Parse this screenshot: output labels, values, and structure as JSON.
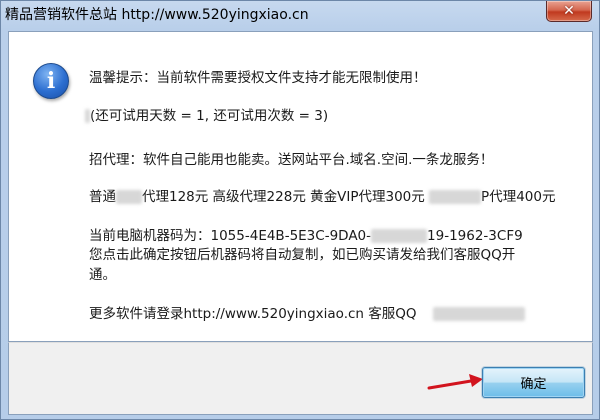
{
  "window": {
    "title": "精品营销软件总站 http://www.520yingxiao.cn",
    "close_symbol": "✕"
  },
  "dialog": {
    "icon": "info-icon",
    "lines": {
      "line1": "温馨提示：当前软件需要授权文件支持才能无限制使用！",
      "line2": "(还可试用天数 = 1, 还可试用次数 = 3)",
      "line3": "招代理：软件自己能用也能卖。送网站平台.域名.空间.一条龙服务！",
      "line4a": "普通",
      "line4b": "代理128元 高级代理228元 黄金VIP代理300元 ",
      "line4c": "P代理400元",
      "line5a": "当前电脑机器码为：1055-4E4B-5E3C-9DA0-",
      "line5b": "19-1962-3CF9",
      "line6": "您点击此确定按钮后机器码将自动复制，如已购买请发给我们客服QQ开",
      "line7": "通。",
      "line8": "更多软件请登录http://www.520yingxiao.cn  客服QQ"
    }
  },
  "footer": {
    "ok_label": "确定",
    "arrow_color": "#d2141e"
  }
}
